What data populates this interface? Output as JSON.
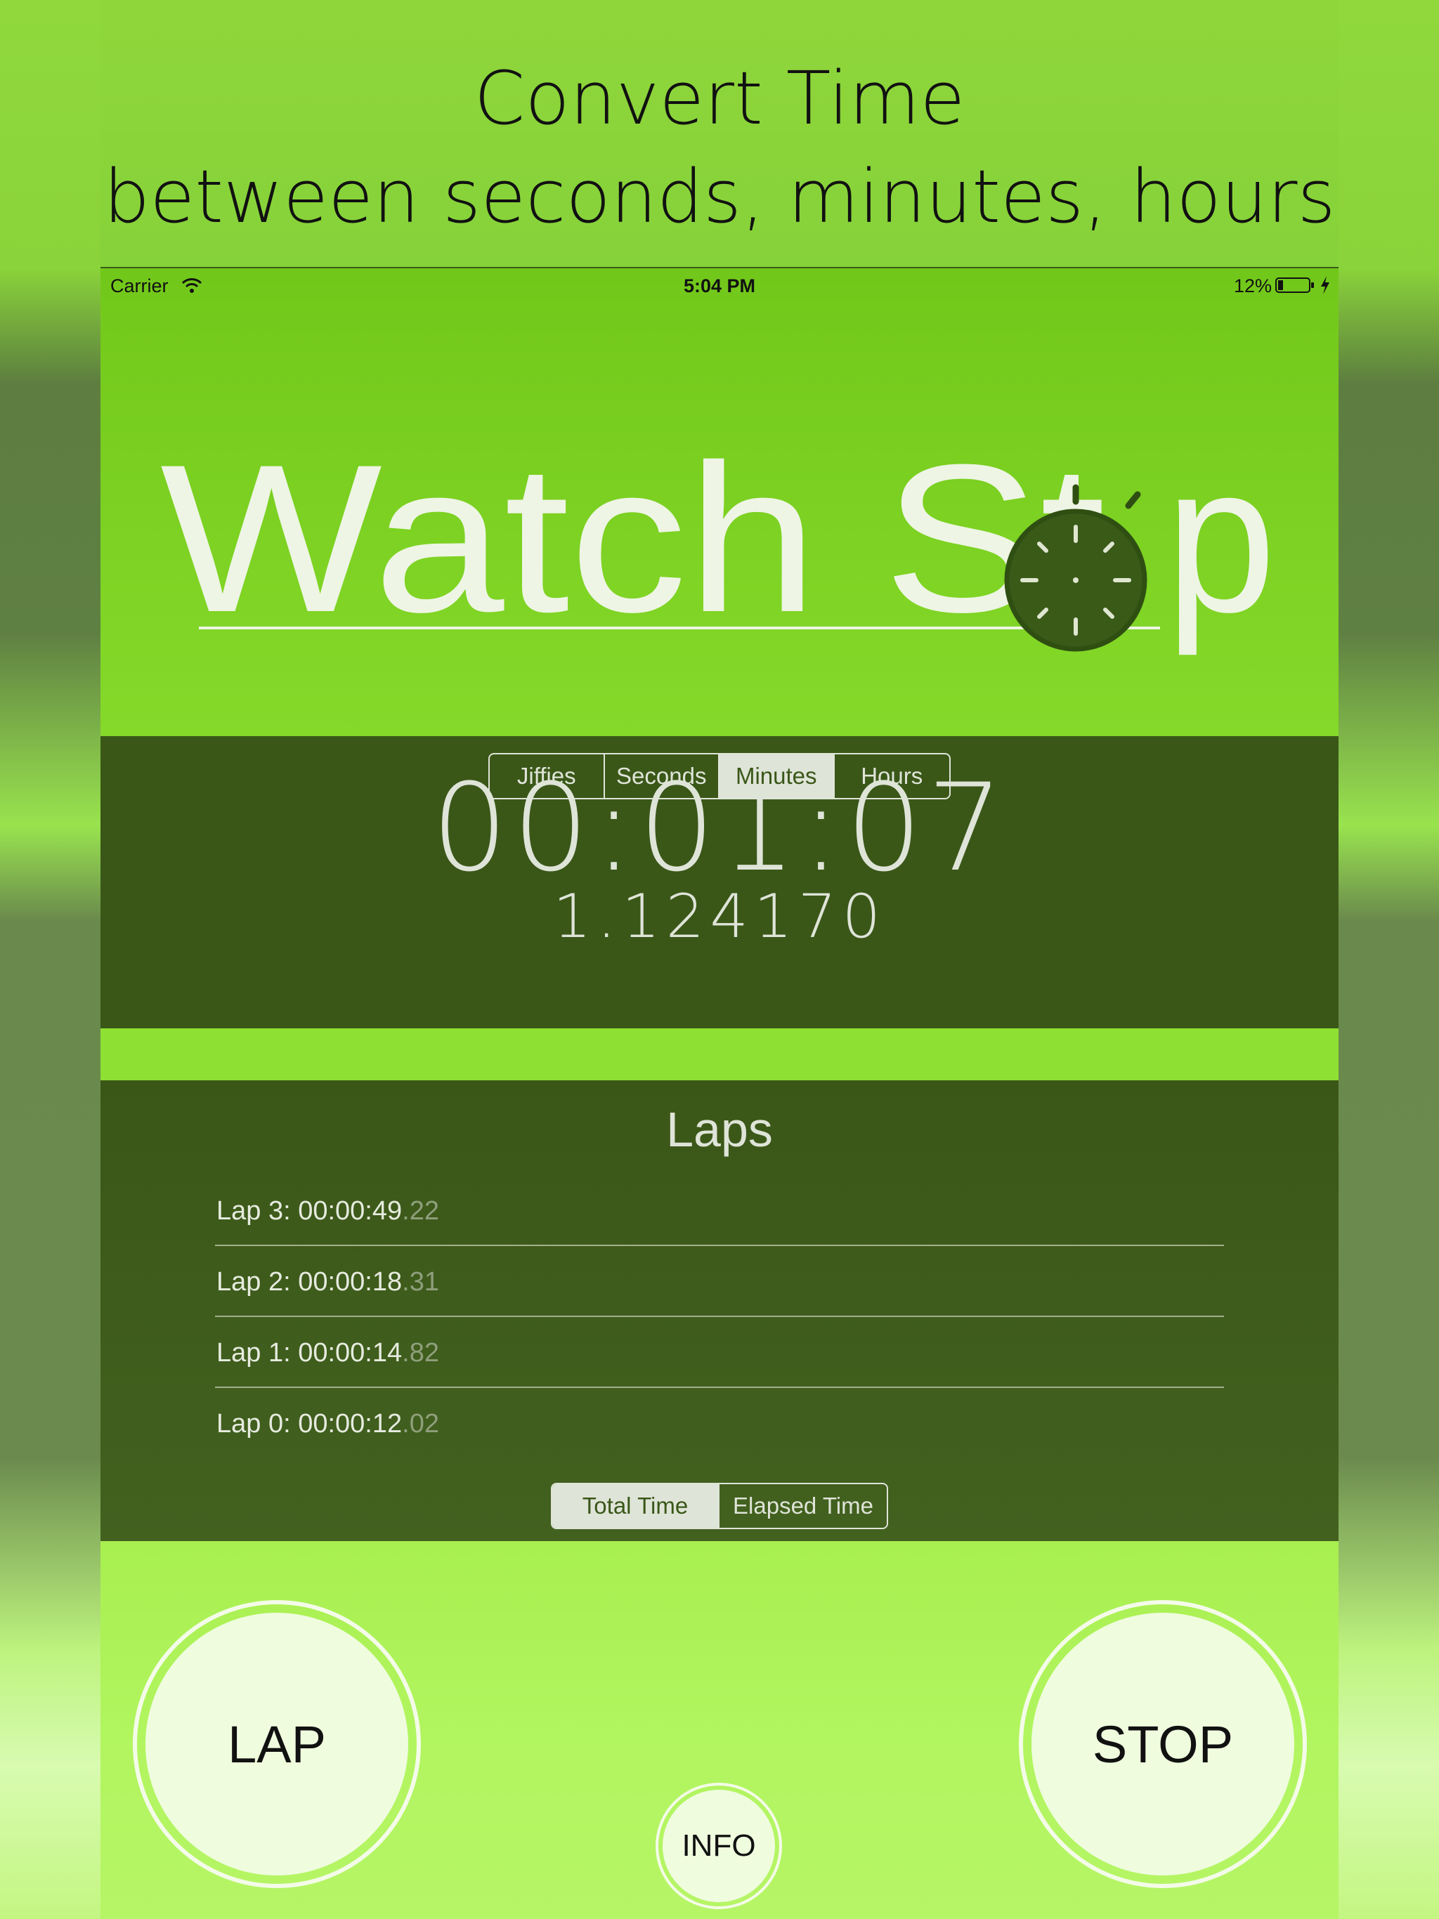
{
  "headline": {
    "line1": "Convert Time",
    "line2": "between seconds, minutes, hours"
  },
  "statusbar": {
    "carrier": "Carrier",
    "time": "5:04 PM",
    "battery": "12%"
  },
  "logo": {
    "text_left": "Watch St",
    "text_right": "p"
  },
  "timer": {
    "display": "00:01:07",
    "converted": "1.124170",
    "units": [
      "Jiffies",
      "Seconds",
      "Minutes",
      "Hours"
    ],
    "selected_unit": "Minutes"
  },
  "laps": {
    "title": "Laps",
    "items": [
      {
        "label": "Lap 3: 00:00:49",
        "fraction": ".22"
      },
      {
        "label": "Lap 2: 00:00:18",
        "fraction": ".31"
      },
      {
        "label": "Lap 1: 00:00:14",
        "fraction": ".82"
      },
      {
        "label": "Lap 0: 00:00:12",
        "fraction": ".02"
      }
    ],
    "modes": [
      "Total Time",
      "Elapsed Time"
    ],
    "selected_mode": "Total Time"
  },
  "buttons": {
    "lap": "LAP",
    "stop": "STOP",
    "info": "INFO"
  },
  "colors": {
    "panel": "#3a5718",
    "accent": "#8ee033",
    "text_light": "#dfe4d8"
  }
}
